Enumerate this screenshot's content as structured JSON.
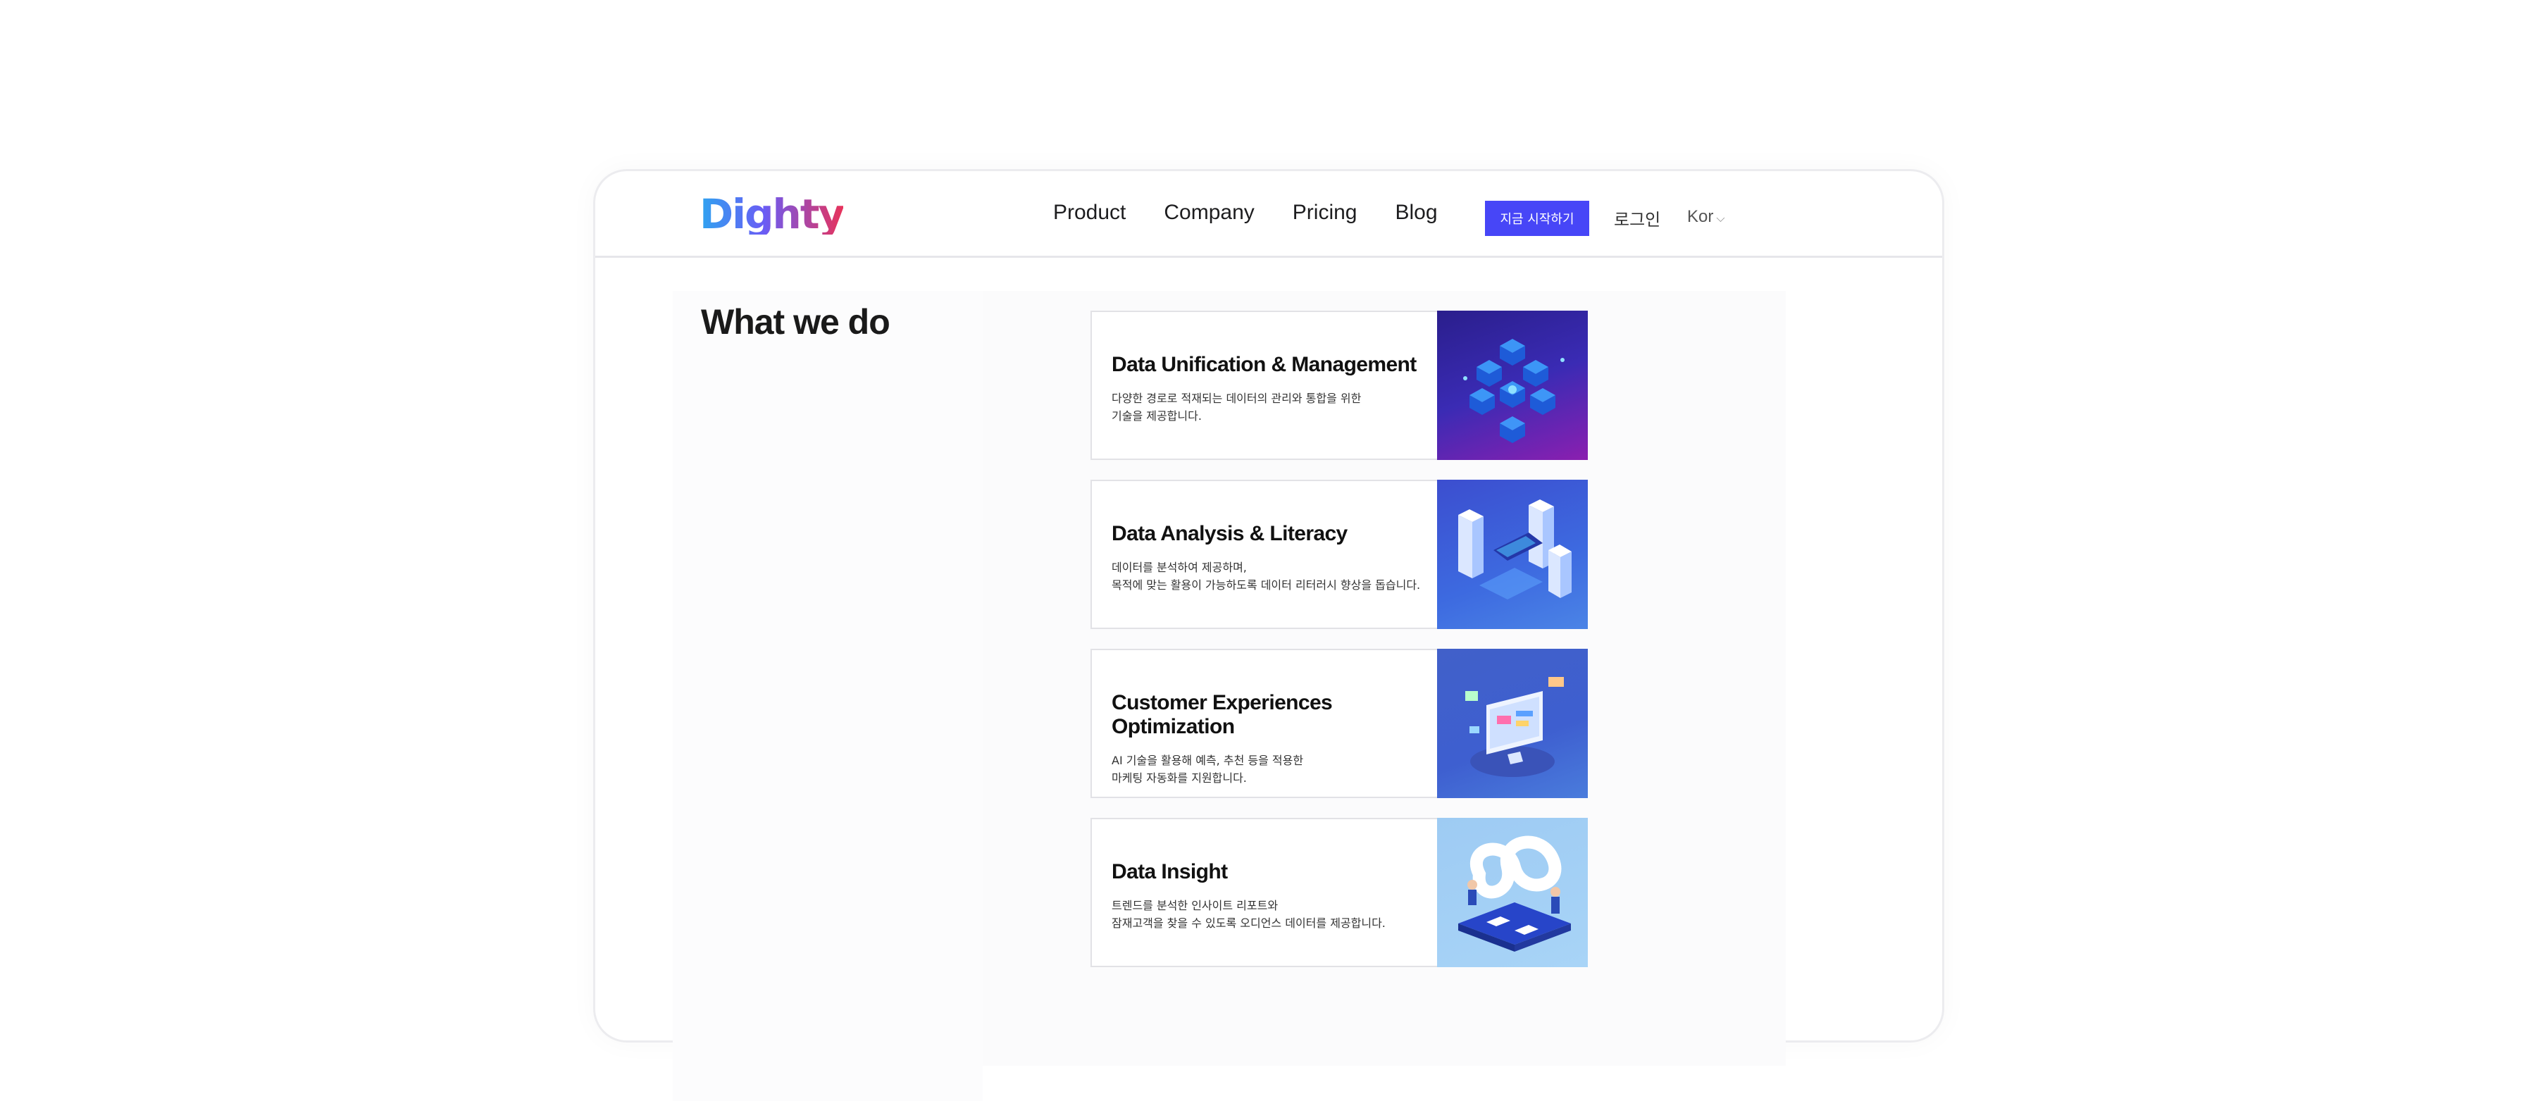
{
  "brand": {
    "logo_text": "Dighty"
  },
  "nav": {
    "links": [
      "Product",
      "Company",
      "Pricing",
      "Blog"
    ],
    "cta_label": "지금 시작하기",
    "login_label": "로그인",
    "language": "Kor"
  },
  "section": {
    "title": "What we do",
    "cards": [
      {
        "title": "Data Unification & Management",
        "desc_line1": "다양한 경로로 적재되는 데이터의 관리와 통합을 위한",
        "desc_line2": "기술을 제공합니다."
      },
      {
        "title": "Data Analysis & Literacy",
        "desc_line1": "데이터를 분석하여 제공하며,",
        "desc_line2": "목적에 맞는 활용이 가능하도록 데이터 리터러시 향상을 돕습니다."
      },
      {
        "title": "Customer Experiences Optimization",
        "desc_line1": "AI 기술을 활용해 예측, 추천 등을 적용한",
        "desc_line2": "마케팅 자동화를 지원합니다."
      },
      {
        "title": "Data Insight",
        "desc_line1": "트렌드를 분석한 인사이트 리포트와",
        "desc_line2": "잠재고객을 찾을 수 있도록 오디언스 데이터를 제공합니다."
      }
    ]
  },
  "colors": {
    "cta": "#4746f7",
    "border": "#e2e2e6"
  }
}
